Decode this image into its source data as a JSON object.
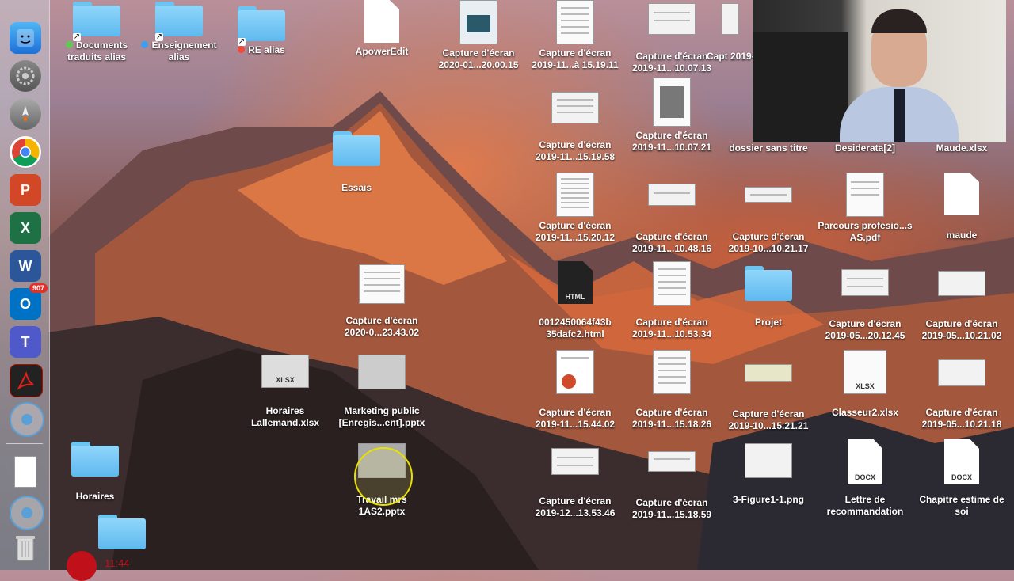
{
  "dock": {
    "items": [
      {
        "name": "finder",
        "label": ""
      },
      {
        "name": "system-preferences",
        "label": ""
      },
      {
        "name": "launchpad",
        "label": ""
      },
      {
        "name": "chrome",
        "label": ""
      },
      {
        "name": "powerpoint",
        "label": "P"
      },
      {
        "name": "excel",
        "label": "X"
      },
      {
        "name": "word",
        "label": "W"
      },
      {
        "name": "outlook",
        "label": "O",
        "badge": "907"
      },
      {
        "name": "teams",
        "label": "T"
      },
      {
        "name": "acrobat",
        "label": ""
      },
      {
        "name": "app",
        "label": ""
      },
      {
        "name": "document",
        "label": ""
      },
      {
        "name": "app",
        "label": ""
      },
      {
        "name": "trash",
        "label": ""
      }
    ]
  },
  "desktop": {
    "documents_traduits": "Documents traduits alias",
    "enseignement": "Enseignement alias",
    "re_alias": "RE alias",
    "apoweredit": "ApowerEdit",
    "cap_2020_01": "Capture d'écran 2020-01...20.00.15",
    "cap_2019_11_a": "Capture d'écran 2019-11...à 15.19.11",
    "cap_2019_11_b": "Capture d'écran 2019-11...10.07.13",
    "cap_partial_top": "Capt 2019-",
    "cap_2019_11_c": "Capture d'écran 2019-11...15.19.58",
    "cap_2019_11_d": "Capture d'écran 2019-11...10.07.21",
    "dossier_sans_titre": "dossier sans titre",
    "desiderata": "Desiderata[2]",
    "maude_xlsx": "Maude.xlsx",
    "essais": "Essais",
    "cap_2019_11_e": "Capture d'écran 2019-11...15.20.12",
    "cap_2019_11_f": "Capture d'écran 2019-11...10.48.16",
    "cap_2019_10_a": "Capture d'écran 2019-10...10.21.17",
    "parcours": "Parcours profesio...s AS.pdf",
    "maude": "maude",
    "cap_2020_0": "Capture d'écran 2020-0...23.43.02",
    "html_file": "0012450064f43b 35dafc2.html",
    "cap_2019_11_g": "Capture d'écran 2019-11...10.53.34",
    "projet": "Projet",
    "cap_2019_05_a": "Capture d'écran 2019-05...20.12.45",
    "cap_2019_05_b": "Capture d'écran 2019-05...10.21.02",
    "horaires_allemand": "Horaires Lallemand.xlsx",
    "marketing": "Marketing public [Enregis...ent].pptx",
    "cap_2019_11_h": "Capture d'écran 2019-11...15.44.02",
    "cap_2019_11_i": "Capture d'écran 2019-11...15.18.26",
    "cap_2019_10_b": "Capture d'écran 2019-10...15.21.21",
    "classeur2": "Classeur2.xlsx",
    "cap_2019_05_c": "Capture d'écran 2019-05...10.21.18",
    "horaires": "Horaires",
    "travail": "Travail mrs 1AS2.pptx",
    "cap_2019_12": "Capture d'écran 2019-12...13.53.46",
    "cap_2019_11_j": "Capture d'écran 2019-11...15.18.59",
    "figure": "3-Figure1-1.png",
    "lettre": "Lettre de recommandation",
    "chapitre": "Chapitre estime de soi"
  },
  "badges": {
    "xlsx": "XLSX",
    "html": "HTML",
    "docx": "DOCX"
  },
  "recording": {
    "time": "11:44"
  },
  "colors": {
    "tag_green": "#5ccb4f",
    "tag_blue": "#3a9ff0",
    "tag_red": "#f0483a"
  }
}
